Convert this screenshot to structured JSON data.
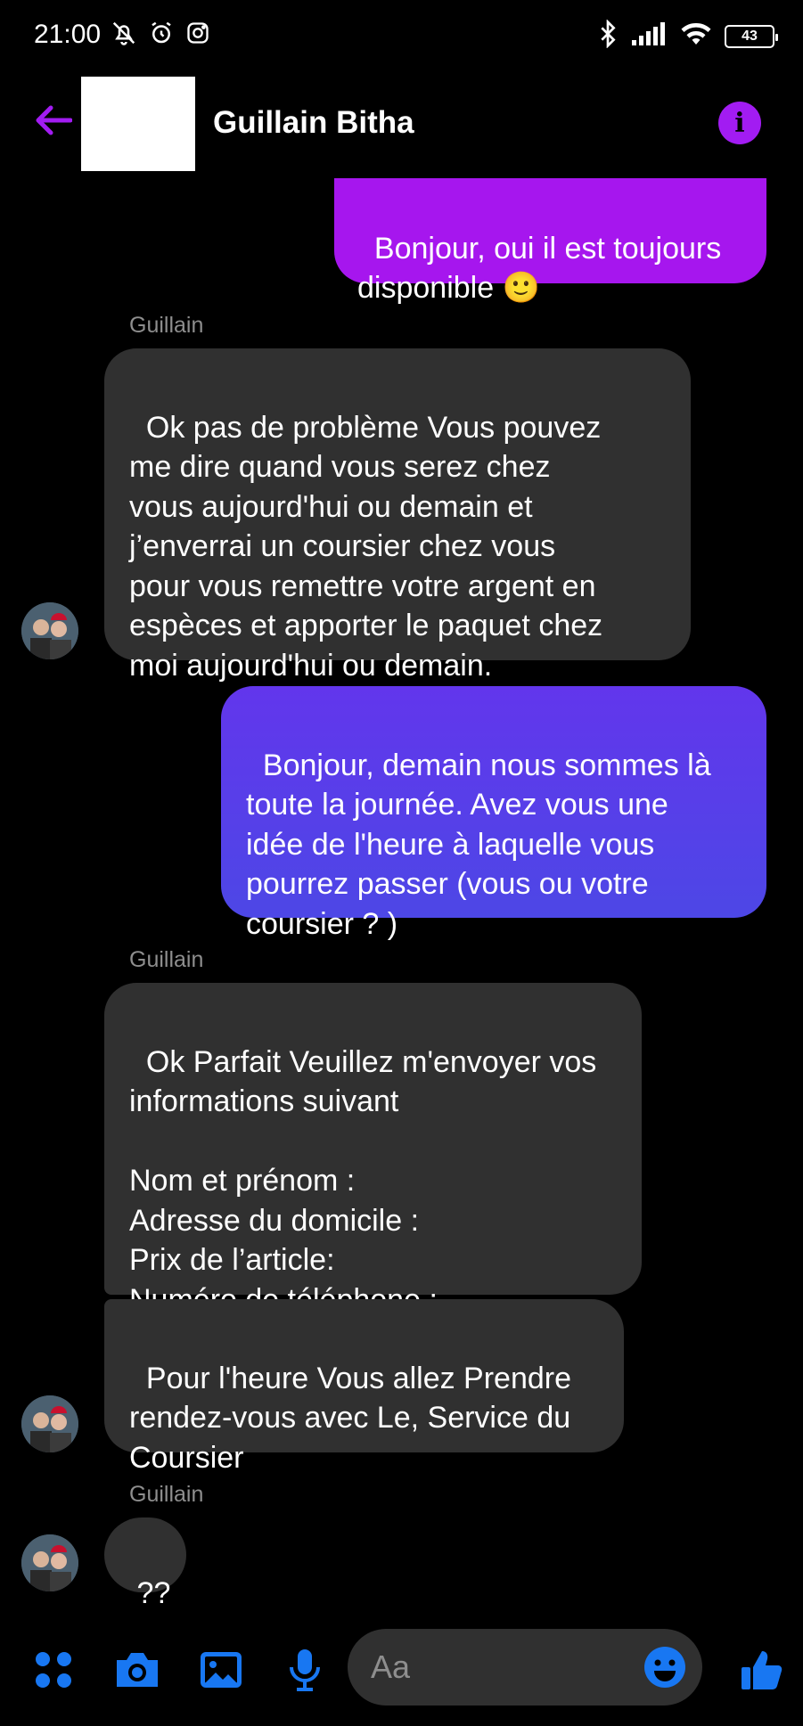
{
  "status_bar": {
    "time": "21:00",
    "battery": "43",
    "icons": [
      "bell-off-icon",
      "alarm-icon",
      "instagram-icon",
      "bluetooth-icon",
      "signal-icon",
      "wifi-icon",
      "battery-icon"
    ]
  },
  "header": {
    "contact_name": "Guillain Bitha",
    "info_label": "i"
  },
  "messages": [
    {
      "direction": "outgoing",
      "text": "Bonjour, oui il est toujours\ndisponible 🙂"
    },
    {
      "direction": "incoming",
      "sender": "Guillain",
      "text": "Ok pas de problème Vous pouvez\nme dire quand vous serez chez\nvous aujourd'hui ou demain et\nj’enverrai un coursier chez vous\npour vous remettre votre argent en\nespèces et apporter le paquet chez\nmoi aujourd'hui ou demain."
    },
    {
      "direction": "outgoing",
      "text": "Bonjour, demain nous sommes là\ntoute la journée. Avez vous une\nidée de l'heure à laquelle vous\npourrez passer (vous ou votre\ncoursier ? )"
    },
    {
      "direction": "incoming",
      "sender": "Guillain",
      "text": "Ok Parfait Veuillez m'envoyer vos\ninformations suivant\n\nNom et prénom :\nAdresse du domicile :\nPrix de l’article:\nNuméro de téléphone :"
    },
    {
      "direction": "incoming",
      "text": "Pour l'heure Vous allez Prendre\nrendez-vous avec Le, Service du\nCoursier"
    },
    {
      "direction": "incoming",
      "sender": "Guillain",
      "text": "??"
    }
  ],
  "composer": {
    "placeholder": "Aa",
    "buttons": [
      "apps-icon",
      "camera-icon",
      "gallery-icon",
      "microphone-icon",
      "emoji-icon",
      "thumbs-up-icon"
    ]
  },
  "colors": {
    "accent": "#a21cf2",
    "bubble_outgoing_top": "#a616ee",
    "bubble_outgoing_bottom": "#4d47e6",
    "bubble_incoming": "#303030",
    "composer_icons": "#1877f2"
  }
}
